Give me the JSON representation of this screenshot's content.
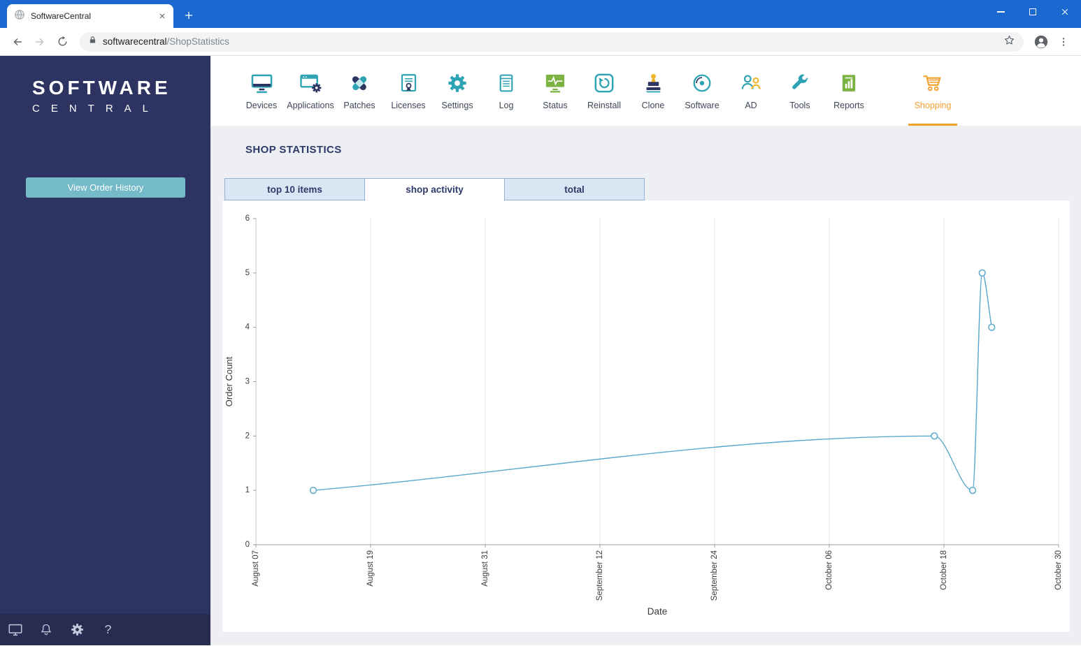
{
  "colors": {
    "chrome-blue": "#1a67cf",
    "navy": "#2d3462",
    "navy-dark": "#272c50",
    "teal": "#2ea3b4",
    "teal-button": "#74bac8",
    "green": "#7cb342",
    "yellow": "#f0b42a",
    "orange": "#f59f2d",
    "page-bg": "#edeff2",
    "tab-inactive-bg": "#d9e6f3",
    "tab-border": "#8fb3da",
    "heading": "#2d3a6b",
    "line": "#58a9cd"
  },
  "browser": {
    "tab_title": "SoftwareCentral",
    "url_host": "softwarecentral",
    "url_path": "/ShopStatistics"
  },
  "sidebar": {
    "logo_line1": "SOFTWARE",
    "logo_line2": "CENTRAL",
    "order_history_button": "View Order History",
    "footer_icons": [
      "monitor-icon",
      "bell-icon",
      "gear-icon",
      "help-icon"
    ]
  },
  "nav": {
    "active": "Shopping",
    "items": [
      {
        "label": "Devices",
        "icon": "devices-icon"
      },
      {
        "label": "Applications",
        "icon": "applications-icon"
      },
      {
        "label": "Patches",
        "icon": "patches-icon"
      },
      {
        "label": "Licenses",
        "icon": "licenses-icon"
      },
      {
        "label": "Settings",
        "icon": "settings-icon"
      },
      {
        "label": "Log",
        "icon": "log-icon"
      },
      {
        "label": "Status",
        "icon": "status-icon"
      },
      {
        "label": "Reinstall",
        "icon": "reinstall-icon"
      },
      {
        "label": "Clone",
        "icon": "clone-icon"
      },
      {
        "label": "Software",
        "icon": "software-icon"
      },
      {
        "label": "AD",
        "icon": "ad-icon"
      },
      {
        "label": "Tools",
        "icon": "tools-icon"
      },
      {
        "label": "Reports",
        "icon": "reports-icon"
      },
      {
        "label": "Shopping",
        "icon": "shopping-cart-icon"
      }
    ]
  },
  "main": {
    "heading": "SHOP STATISTICS",
    "tabs": [
      {
        "label": "top 10 items",
        "active": false
      },
      {
        "label": "shop activity",
        "active": true
      },
      {
        "label": "total",
        "active": false
      }
    ]
  },
  "chart_data": {
    "type": "line",
    "title": "",
    "xlabel": "Date",
    "ylabel": "Order Count",
    "ylim": [
      0,
      6
    ],
    "y_ticks": [
      0,
      1,
      2,
      3,
      4,
      5,
      6
    ],
    "x_unit": "days since August 07",
    "grid": "vertical-only",
    "legend": "none",
    "x_ticks": [
      {
        "day": 0,
        "label": "August 07"
      },
      {
        "day": 12,
        "label": "August 19"
      },
      {
        "day": 24,
        "label": "August 31"
      },
      {
        "day": 36,
        "label": "September 12"
      },
      {
        "day": 48,
        "label": "September 24"
      },
      {
        "day": 60,
        "label": "October 06"
      },
      {
        "day": 72,
        "label": "October 18"
      },
      {
        "day": 84,
        "label": "October 30"
      }
    ],
    "series": [
      {
        "name": "Order Count",
        "color": "#58a9cd",
        "marker": "open-circle",
        "points": [
          {
            "day": 6,
            "date": "August 13",
            "value": 1
          },
          {
            "day": 71,
            "date": "October 17",
            "value": 2
          },
          {
            "day": 75,
            "date": "October 21",
            "value": 1
          },
          {
            "day": 76,
            "date": "October 22",
            "value": 5
          },
          {
            "day": 77,
            "date": "October 23",
            "value": 4
          }
        ]
      }
    ]
  }
}
